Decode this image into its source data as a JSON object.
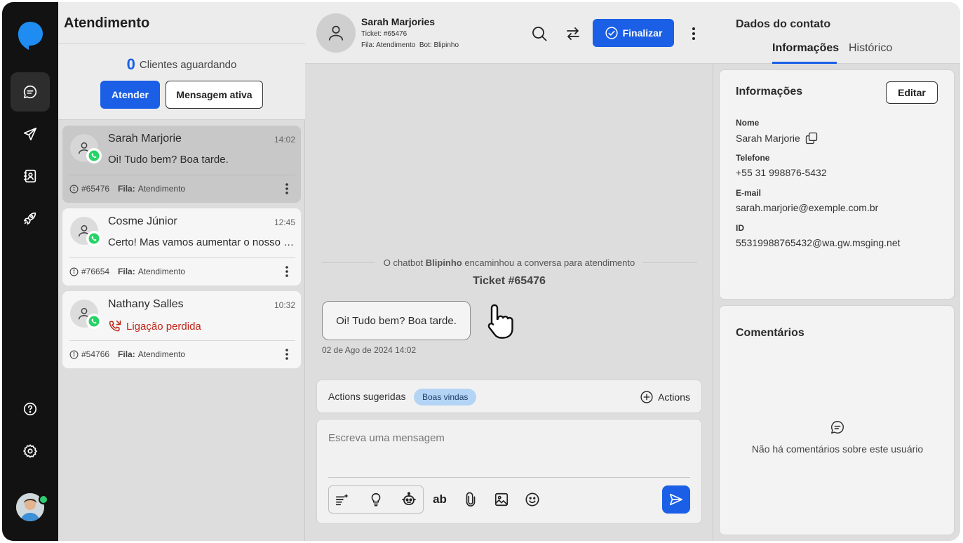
{
  "queue": {
    "title": "Atendimento",
    "waiting_count": "0",
    "waiting_label": "Clientes aguardando",
    "attend_label": "Atender",
    "active_message_label": "Mensagem ativa",
    "conversations": [
      {
        "name": "Sarah Marjorie",
        "time": "14:02",
        "message": "Oi! Tudo bem? Boa tarde.",
        "ticket": "#65476",
        "queue_label": "Fila:",
        "queue": "Atendimento",
        "selected": true,
        "missed_call": false
      },
      {
        "name": "Cosme Júnior",
        "time": "12:45",
        "message": "Certo! Mas vamos aumentar o nosso prazo",
        "ticket": "#76654",
        "queue_label": "Fila:",
        "queue": "Atendimento",
        "selected": false,
        "missed_call": false
      },
      {
        "name": "Nathany Salles",
        "time": "10:32",
        "message": "Ligação perdida",
        "ticket": "#54766",
        "queue_label": "Fila:",
        "queue": "Atendimento",
        "selected": false,
        "missed_call": true
      }
    ]
  },
  "chat": {
    "contact_name": "Sarah Marjories",
    "ticket_label": "Ticket:",
    "ticket": "#65476",
    "queue_label": "Fila:",
    "queue": "Atendimento",
    "bot_label": "Bot:",
    "bot": "Blipinho",
    "finalize_label": "Finalizar",
    "system_prefix": "O chatbot",
    "system_bot": "Blipinho",
    "system_suffix": "encaminhou a conversa para atendimento",
    "ticket_title": "Ticket #65476",
    "message_text": "Oi! Tudo bem? Boa tarde.",
    "message_time": "02 de Ago de 2024 14:02",
    "suggested_label": "Actions sugeridas",
    "suggested_chip": "Boas vindas",
    "actions_label": "Actions",
    "composer_placeholder": "Escreva uma mensagem",
    "format_label": "ab"
  },
  "contact": {
    "panel_title": "Dados do contato",
    "tabs": [
      "Informações",
      "Histórico"
    ],
    "info_title": "Informações",
    "edit_label": "Editar",
    "fields": [
      {
        "label": "Nome",
        "value": "Sarah Marjorie"
      },
      {
        "label": "Telefone",
        "value": "+55 31 998876-5432"
      },
      {
        "label": "E-mail",
        "value": "sarah.marjorie@exemple.com.br"
      },
      {
        "label": "ID",
        "value": "55319988765432@wa.gw.msging.net"
      }
    ],
    "comments_title": "Comentários",
    "comments_empty": "Não há comentários sobre este usuário"
  },
  "colors": {
    "accent": "#1a5fe6",
    "missed": "#c0261a",
    "online": "#2ecc71",
    "nav_bg": "#121212",
    "logo": "#1e8cf0",
    "whatsapp": "#25d366"
  }
}
